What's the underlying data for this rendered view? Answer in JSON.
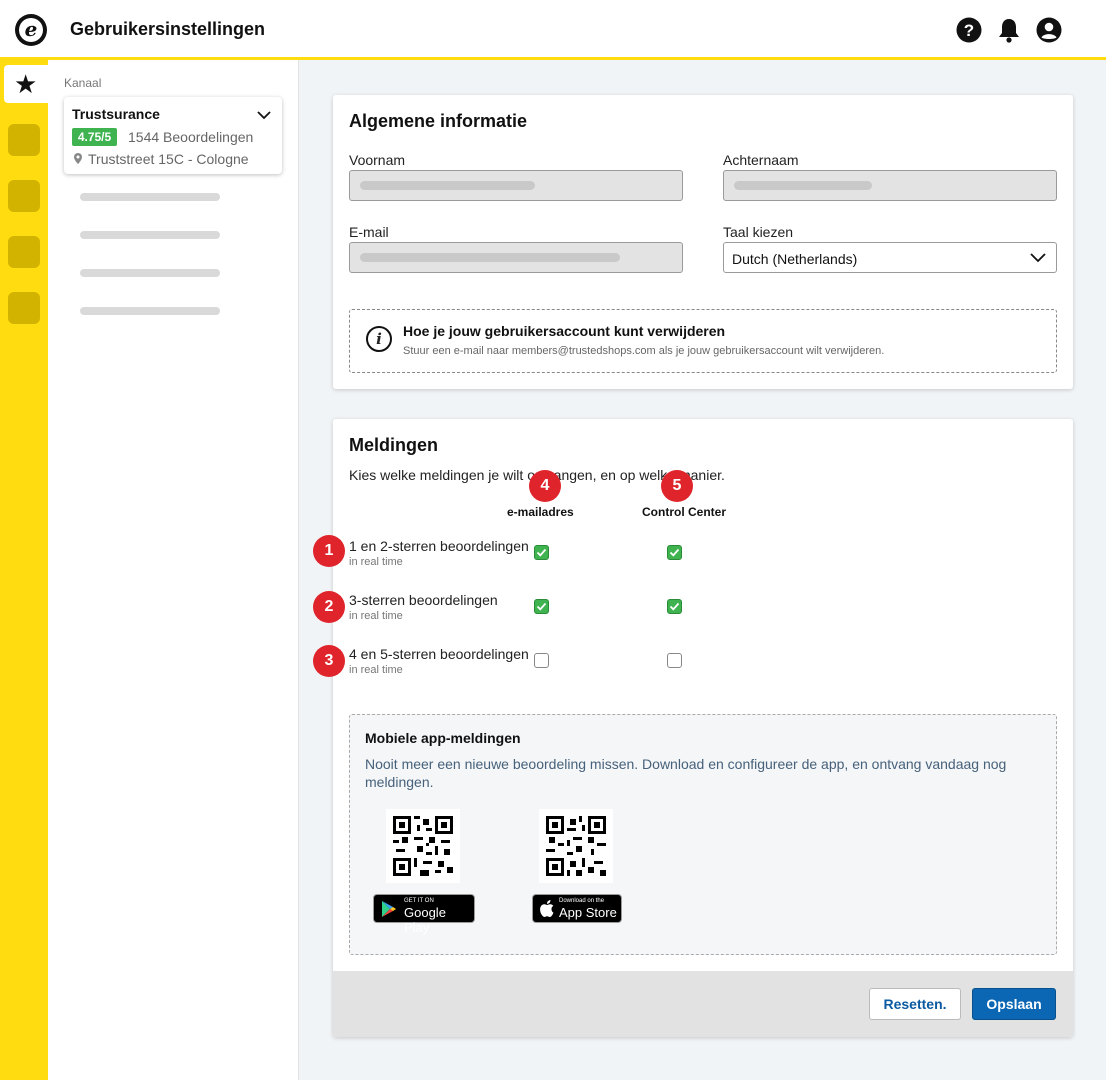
{
  "header": {
    "logo_letter": "e",
    "title": "Gebruikersinstellingen",
    "icons": [
      "help-icon",
      "bell-icon",
      "user-account-icon"
    ]
  },
  "sidebar": {
    "active_icon": "★",
    "channel_label": "Kanaal",
    "channel": {
      "name": "Trustsurance",
      "rating": "4.75/5",
      "reviews": "1544 Beoordelingen",
      "address": "Truststreet 15C - Cologne"
    }
  },
  "general": {
    "title": "Algemene informatie",
    "firstname_label": "Voornam",
    "lastname_label": "Achternaam",
    "email_label": "E-mail",
    "language_label": "Taal kiezen",
    "language_value": "Dutch (Netherlands)",
    "info_title": "Hoe je jouw gebruikersaccount kunt verwijderen",
    "info_text": "Stuur een e-mail naar members@trustedshops.com als je jouw gebruikersaccount wilt verwijderen."
  },
  "notifications": {
    "title": "Meldingen",
    "description": "Kies welke meldingen je wilt ontvangen, en op welke manier.",
    "columns": [
      {
        "label": "e-mailadres",
        "callout": "4"
      },
      {
        "label": "Control Center",
        "callout": "5"
      }
    ],
    "rows": [
      {
        "callout": "1",
        "label": "1 en 2-sterren beoordelingen",
        "sub": "in real time",
        "email": true,
        "control_center": true
      },
      {
        "callout": "2",
        "label": "3-sterren beoordelingen",
        "sub": "in real time",
        "email": true,
        "control_center": true
      },
      {
        "callout": "3",
        "label": "4 en 5-sterren beoordelingen",
        "sub": "in real time",
        "email": false,
        "control_center": false
      }
    ],
    "mobile": {
      "title": "Mobiele app-meldingen",
      "text": "Nooit meer een nieuwe beoordeling missen. Download en configureer de app, en ontvang vandaag nog meldingen.",
      "google_small": "GET IT ON",
      "google_big": "Google Play",
      "apple_small": "Download on the",
      "apple_big": "App Store"
    }
  },
  "footer": {
    "reset_label": "Resetten.",
    "save_label": "Opslaan"
  },
  "colors": {
    "brand_yellow": "#ffdc0f",
    "rating_green": "#3fb34f",
    "callout_red": "#e0242b",
    "primary_blue": "#0b67b4"
  }
}
